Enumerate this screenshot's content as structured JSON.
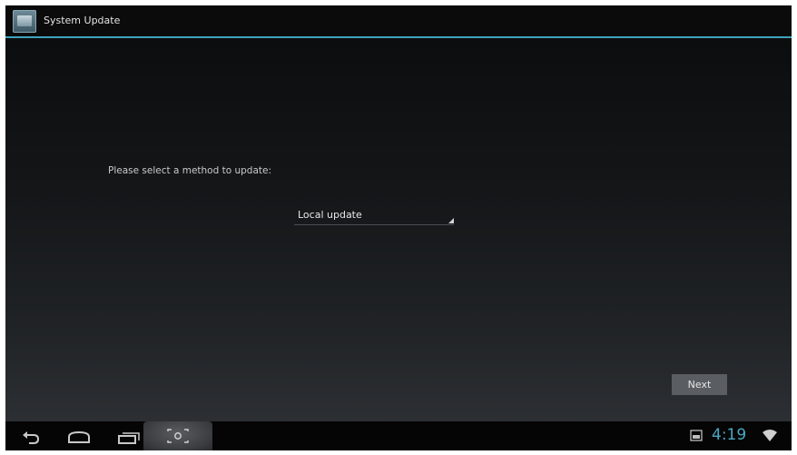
{
  "window": {
    "title": "System Update",
    "app_icon": "system-update-app-icon"
  },
  "main": {
    "prompt": "Please select a method to update:",
    "method_select": {
      "selected": "Local update"
    },
    "next_label": "Next"
  },
  "navigation": {
    "back_icon": "back-icon",
    "home_icon": "home-icon",
    "recents_icon": "recent-apps-icon",
    "screenshot_icon": "screenshot-icon"
  },
  "status": {
    "time": "4:19",
    "gallery_icon": "gallery-notification-icon",
    "wifi_icon": "wifi-icon",
    "accent_color": "#4aa8c6"
  }
}
